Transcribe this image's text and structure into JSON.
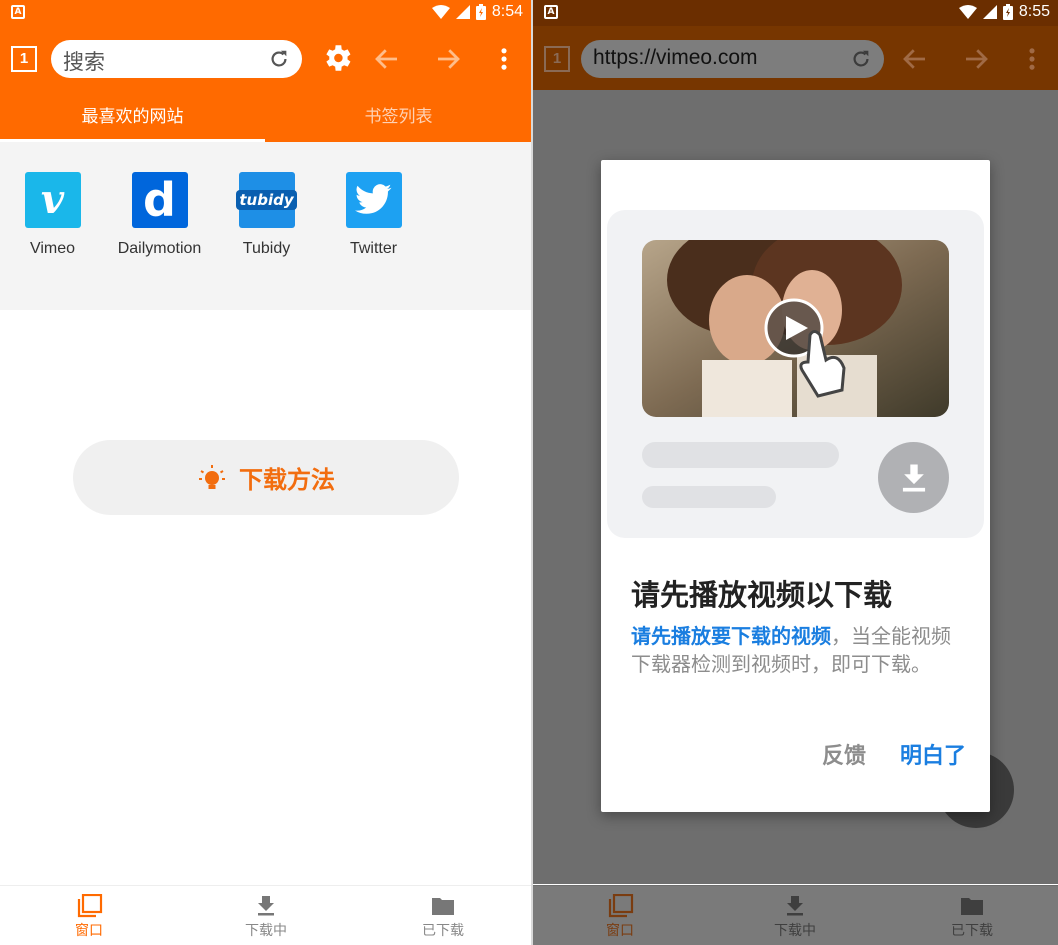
{
  "colors": {
    "brand_orange": "#ff6a00",
    "dim_orange": "#773600",
    "overlay_gray": "#6e6e6e",
    "link_blue": "#1a7ee0"
  },
  "left_screen": {
    "status": {
      "time": "8:54",
      "notif_letter": "A"
    },
    "toolbar": {
      "tab_count": "1",
      "search_placeholder": "搜索",
      "icons": [
        "reload-icon",
        "gear-icon",
        "arrow-left-icon",
        "arrow-right-icon",
        "more-vert-icon"
      ]
    },
    "tabs": [
      {
        "label": "最喜欢的网站",
        "active": true
      },
      {
        "label": "书签列表",
        "active": false
      }
    ],
    "favorites": [
      {
        "name": "Vimeo",
        "logo_text": "v",
        "color": "#1ab7ea"
      },
      {
        "name": "Dailymotion",
        "logo_text": "d",
        "color": "#0066dc"
      },
      {
        "name": "Tubidy",
        "logo_text": "tubidy",
        "color": "#1e8fe6"
      },
      {
        "name": "Twitter",
        "logo_text": "",
        "color": "#1da1f2"
      }
    ],
    "howto_button": "下载方法",
    "bottom_nav": [
      {
        "label": "窗口",
        "icon": "windows-icon",
        "active": true
      },
      {
        "label": "下载中",
        "icon": "download-icon",
        "active": false
      },
      {
        "label": "已下载",
        "icon": "folder-icon",
        "active": false
      }
    ]
  },
  "right_screen": {
    "status": {
      "time": "8:55",
      "notif_letter": "A"
    },
    "toolbar": {
      "tab_count": "1",
      "url": "https://vimeo.com"
    },
    "dialog": {
      "title": "请先播放视频以下载",
      "body_highlight": "请先播放要下载的视频",
      "body_rest": "，当全能视频下载器检测到视频时，即可下载。",
      "buttons": {
        "feedback": "反馈",
        "ok": "明白了"
      }
    },
    "bottom_nav": [
      {
        "label": "窗口",
        "active": true
      },
      {
        "label": "下载中",
        "active": false
      },
      {
        "label": "已下载",
        "active": false
      }
    ]
  }
}
